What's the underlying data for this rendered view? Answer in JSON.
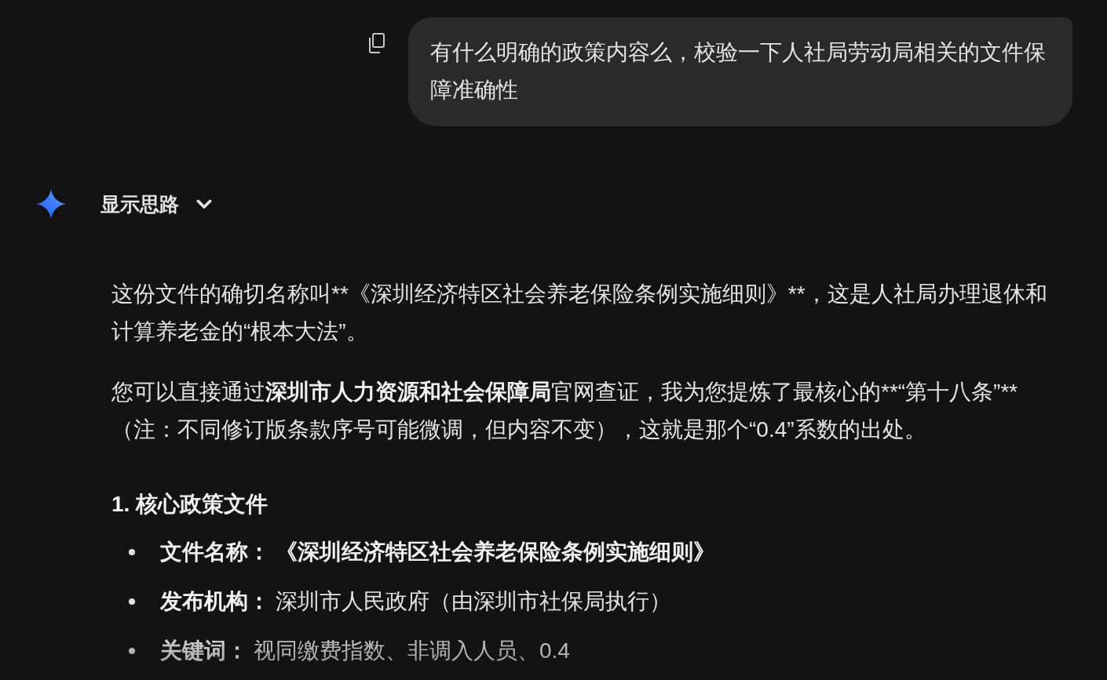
{
  "user_message": {
    "text": "有什么明确的政策内容么，校验一下人社局劳动局相关的文件保障准确性"
  },
  "response": {
    "thoughts_toggle": {
      "label": "显示思路",
      "expanded": false
    },
    "paragraphs": [
      {
        "runs": [
          {
            "text": "这份文件的确切名称叫**《深圳经济特区社会养老保险条例实施细则》**，这是人社局办理退休和计算养老金的“根本大法”。",
            "bold": false
          }
        ]
      },
      {
        "runs": [
          {
            "text": "您可以直接通过",
            "bold": false
          },
          {
            "text": "深圳市人力资源和社会保障局",
            "bold": true
          },
          {
            "text": "官网查证，我为您提炼了最核心的**“第十八条”**（注：不同修订版条款序号可能微调，但内容不变），这就是那个“0.4”系数的出处。",
            "bold": false
          }
        ]
      }
    ],
    "section_heading": "1. 核心政策文件",
    "bullets": [
      {
        "label": "文件名称：",
        "value": "《深圳经济特区社会养老保险条例实施细则》",
        "bold": true
      },
      {
        "label": "发布机构：",
        "value": "深圳市人民政府（由深圳市社保局执行）",
        "bold": false
      },
      {
        "label": "关键词：",
        "value": "视同缴费指数、非调入人员、0.4",
        "bold": false
      }
    ]
  }
}
